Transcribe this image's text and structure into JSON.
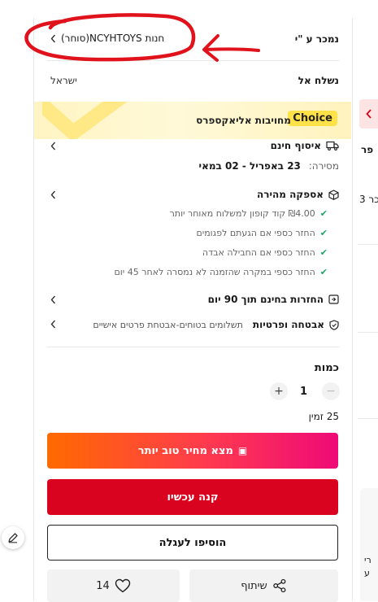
{
  "seller": {
    "label": "נמכר ע \"י",
    "store_name": "חנות NCYHTOYS(סוחר)"
  },
  "ship_to": {
    "label": "נשלח אל",
    "value": "ישראל"
  },
  "choice": {
    "badge": "Choice",
    "text": "מחויבות אליאקספרס"
  },
  "pickup": {
    "title": "איסוף חינם",
    "delivery_label": "מסירה:",
    "delivery_dates": "23 באפריל - 02 במאי"
  },
  "fast_delivery": {
    "title": "אספקה מהירה",
    "items": [
      "₪4.00 קוד קופון למשלוח מאוחר יותר",
      "החזר כספי אם הגעתם לפגומים",
      "החזר כספי אם החבילה אבדה",
      "החזר כספי במקרה שהזמנה לא נמסרה לאחר 45 יום"
    ]
  },
  "returns": {
    "title": "החזרות בחינם תוך 90 יום"
  },
  "security": {
    "title": "אבטחה ופרטיות",
    "subtitle": "תשלומים בטוחים-אבטחת פרטים אישיים"
  },
  "quantity": {
    "label": "כמות",
    "value": "1",
    "minus": "−",
    "plus": "+",
    "available": "25 זמין"
  },
  "buttons": {
    "best_price": "מצא מחיר טוב יותר",
    "buy_now": "קנה עכשיו",
    "add_to_cart": "הוסיפו לעגלה",
    "share": "שיתוף",
    "wishlist_count": "14"
  },
  "right_edge": {
    "text_a": "פר",
    "text_b": "כר 3",
    "text_c": "רי",
    "text_d": "ע"
  },
  "colors": {
    "accent_red": "#d9021f",
    "choice_yellow": "#ffe247",
    "check_green": "#1ea16a",
    "annotation_red": "#e0121b"
  }
}
